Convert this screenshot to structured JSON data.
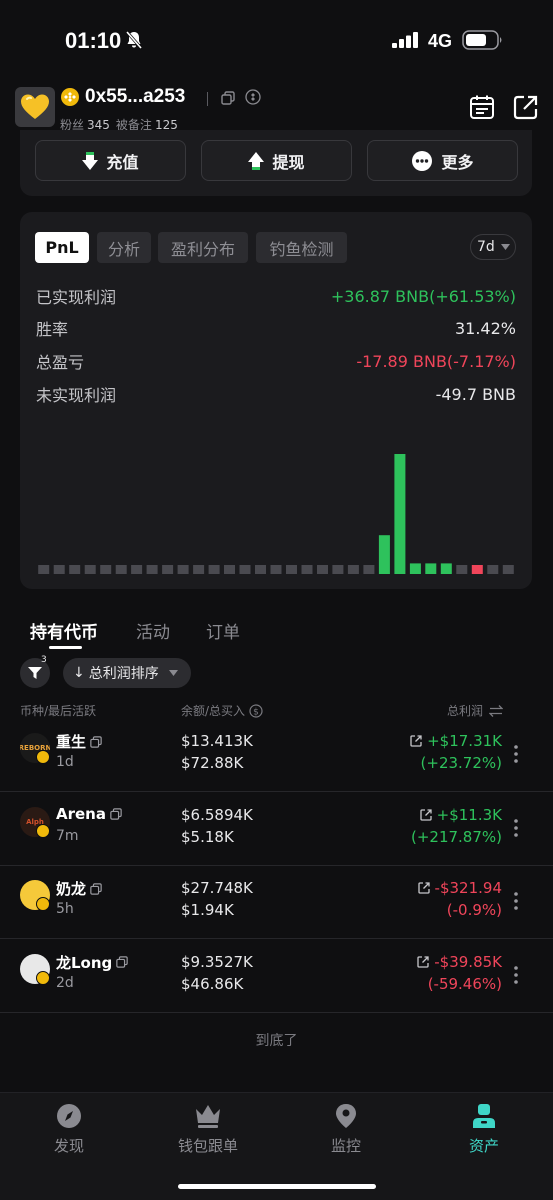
{
  "status_bar": {
    "time": "01:10",
    "network": "4G"
  },
  "header": {
    "address": "0x55...a253",
    "followers_label": "粉丝",
    "followers_count": "345",
    "noted_label": "被备注",
    "noted_count": "125"
  },
  "actions": {
    "deposit": "充值",
    "withdraw": "提现",
    "more": "更多"
  },
  "pnl_card": {
    "tabs": [
      "PnL",
      "分析",
      "盈利分布",
      "钓鱼检测"
    ],
    "range": "7d",
    "stats": [
      {
        "label": "已实现利润",
        "value": "+36.87 BNB(+61.53%)",
        "tone": "pos"
      },
      {
        "label": "胜率",
        "value": "31.42%",
        "tone": "neutral"
      },
      {
        "label": "总盈亏",
        "value": "-17.89 BNB(-7.17%)",
        "tone": "neg"
      },
      {
        "label": "未实现利润",
        "value": "-49.7 BNB",
        "tone": "neutral"
      }
    ]
  },
  "chart_data": {
    "type": "bar",
    "title": "",
    "values": [
      0,
      0,
      0,
      0,
      0,
      0,
      0,
      0,
      0,
      0,
      0,
      0,
      0,
      0,
      0,
      0,
      0,
      0,
      0,
      0,
      0,
      0,
      3.3,
      10.2,
      0.9,
      0.9,
      0.9,
      0,
      0.9,
      0,
      0
    ],
    "colors": {
      "positive": "#2ec25c",
      "negative": "#f0455a",
      "zero": "#4a4a50"
    },
    "negative_indices": [
      28
    ]
  },
  "tabs": {
    "holdings": "持有代币",
    "activity": "活动",
    "orders": "订单"
  },
  "filter": {
    "count": "3",
    "sort_label": "总利润排序"
  },
  "columns": {
    "token": "币种/最后活跃",
    "balance": "余额/总买入",
    "profit": "总利润"
  },
  "tokens": [
    {
      "name": "重生",
      "age": "1d",
      "balance": "$13.413K",
      "bought": "$72.88K",
      "profit": "+$17.31K",
      "pct": "(+23.72%)",
      "tone": "pos",
      "logo_text": "REBORN",
      "logo_bg": "#1a1a1a",
      "logo_fg": "#e8a23a"
    },
    {
      "name": "Arena",
      "age": "7m",
      "balance": "$6.5894K",
      "bought": "$5.18K",
      "profit": "+$11.3K",
      "pct": "(+217.87%)",
      "tone": "pos",
      "logo_text": "Alph",
      "logo_bg": "#2a1a14",
      "logo_fg": "#d0502a"
    },
    {
      "name": "奶龙",
      "age": "5h",
      "balance": "$27.748K",
      "bought": "$1.94K",
      "profit": "-$321.94",
      "pct": "(-0.9%)",
      "tone": "neg",
      "logo_text": "",
      "logo_bg": "#f5c93a",
      "logo_fg": "#333"
    },
    {
      "name": "龙Long",
      "age": "2d",
      "balance": "$9.3527K",
      "bought": "$46.86K",
      "profit": "-$39.85K",
      "pct": "(-59.46%)",
      "tone": "neg",
      "logo_text": "",
      "logo_bg": "#e8e8e8",
      "logo_fg": "#222"
    }
  ],
  "end_text": "到底了",
  "bottom_nav": [
    {
      "label": "发现",
      "icon": "compass-icon",
      "active": false
    },
    {
      "label": "钱包跟单",
      "icon": "crown-icon",
      "active": false
    },
    {
      "label": "监控",
      "icon": "location-icon",
      "active": false
    },
    {
      "label": "资产",
      "icon": "person-icon",
      "active": true
    }
  ]
}
